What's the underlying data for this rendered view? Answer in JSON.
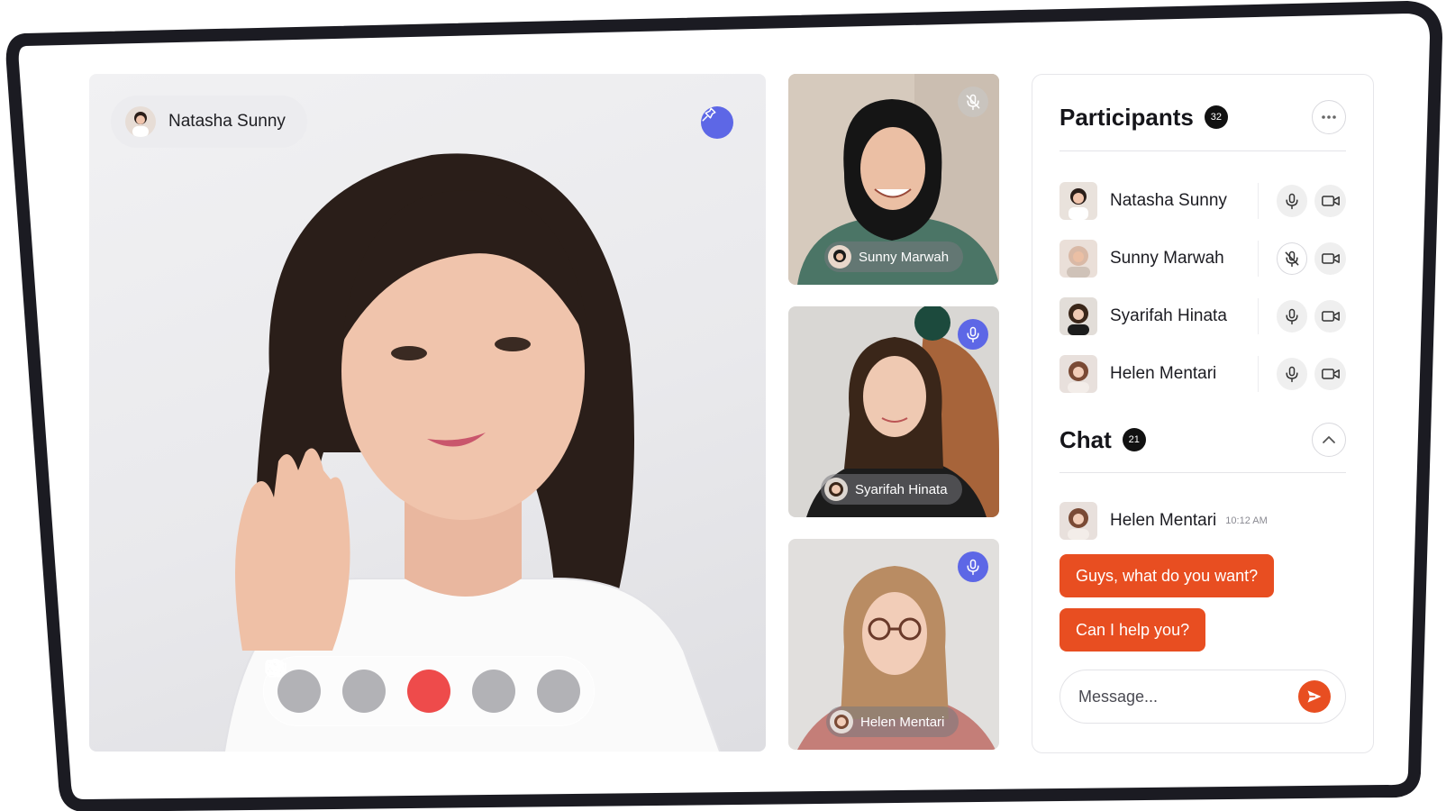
{
  "colors": {
    "accent_blue": "#5d67e6",
    "chat_bubble": "#e84e21",
    "end_call": "#ee4b4b",
    "frame": "#1b1b22"
  },
  "main_video": {
    "speaker_name": "Natasha Sunny",
    "pin_icon": "pin-icon",
    "controls": [
      {
        "name": "microphone",
        "icon": "mic-icon"
      },
      {
        "name": "camera",
        "icon": "video-camera-icon"
      },
      {
        "name": "end-call",
        "icon": "phone-icon"
      },
      {
        "name": "message",
        "icon": "mail-icon"
      },
      {
        "name": "effects",
        "icon": "circles-icon"
      }
    ]
  },
  "tiles": [
    {
      "name": "Sunny Marwah",
      "mic": "muted"
    },
    {
      "name": "Syarifah Hinata",
      "mic": "active"
    },
    {
      "name": "Helen Mentari",
      "mic": "active"
    }
  ],
  "participants": {
    "title": "Participants",
    "count": "32",
    "list": [
      {
        "name": "Natasha Sunny",
        "mic": "on"
      },
      {
        "name": "Sunny Marwah",
        "mic": "muted"
      },
      {
        "name": "Syarifah Hinata",
        "mic": "on"
      },
      {
        "name": "Helen Mentari",
        "mic": "on"
      }
    ]
  },
  "chat": {
    "title": "Chat",
    "count": "21",
    "message": {
      "author": "Helen Mentari",
      "time": "10:12 AM",
      "lines": [
        "Guys, what do you want?",
        "Can I help you?"
      ]
    },
    "input_placeholder": "Message..."
  }
}
